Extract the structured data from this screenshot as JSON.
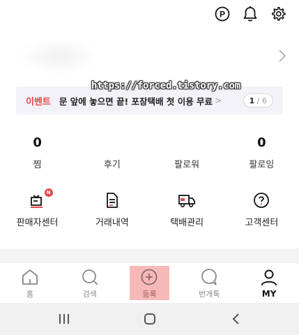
{
  "header": {
    "icons": [
      "point-icon",
      "bell-icon",
      "gear-icon"
    ],
    "point_glyph": "P"
  },
  "watermark": "https://forced.tistory.com",
  "event": {
    "tag": "이벤트",
    "text": "문 앞에 놓으면 끝! 포장택배 첫 이용 무료",
    "arrow": ">",
    "pager_current": "1",
    "pager_sep": " / ",
    "pager_total": "6"
  },
  "stats": [
    {
      "value": "0",
      "label": "찜"
    },
    {
      "value": "",
      "label": "후기"
    },
    {
      "value": "",
      "label": "팔로워"
    },
    {
      "value": "0",
      "label": "팔로잉"
    }
  ],
  "menu": [
    {
      "label": "판매자센터",
      "icon": "seller-center-icon",
      "badge": "N"
    },
    {
      "label": "거래내역",
      "icon": "document-icon"
    },
    {
      "label": "택배관리",
      "icon": "truck-icon"
    },
    {
      "label": "고객센터",
      "icon": "help-icon"
    }
  ],
  "tabs": [
    {
      "label": "홈",
      "icon": "home-icon"
    },
    {
      "label": "검색",
      "icon": "search-icon"
    },
    {
      "label": "등록",
      "icon": "add-icon"
    },
    {
      "label": "번개톡",
      "icon": "chat-icon"
    },
    {
      "label": "MY",
      "icon": "profile-icon"
    }
  ],
  "colors": {
    "accent": "#e8474b",
    "register_highlight": "#f7b8b8",
    "event_bg": "#f2f2f8"
  }
}
